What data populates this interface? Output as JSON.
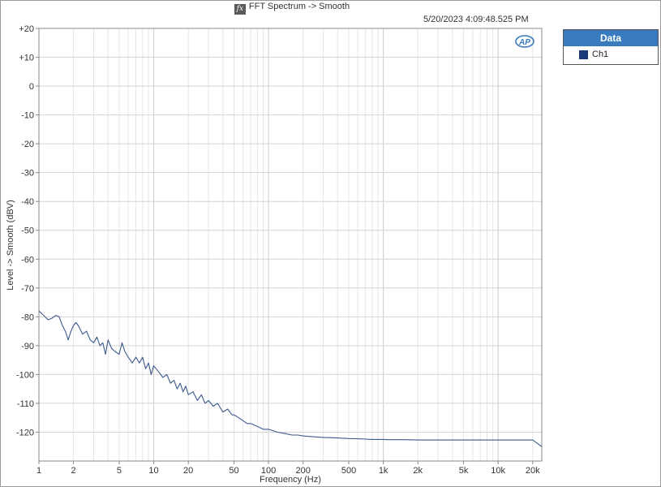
{
  "header": {
    "title": "FFT Spectrum -> Smooth",
    "timestamp": "5/20/2023 4:09:48.525 PM",
    "logo_text": "AP"
  },
  "legend": {
    "title": "Data",
    "items": [
      {
        "name": "Ch1",
        "color": "#1c3a7a"
      }
    ]
  },
  "chart_data": {
    "type": "line",
    "xlabel": "Frequency (Hz)",
    "ylabel": "Level -> Smooth (dBV)",
    "xscale": "log",
    "xlim": [
      1,
      24000
    ],
    "ylim": [
      -130,
      20
    ],
    "xticks": [
      {
        "value": 1,
        "label": "1"
      },
      {
        "value": 2,
        "label": "2"
      },
      {
        "value": 5,
        "label": "5"
      },
      {
        "value": 10,
        "label": "10"
      },
      {
        "value": 20,
        "label": "20"
      },
      {
        "value": 50,
        "label": "50"
      },
      {
        "value": 100,
        "label": "100"
      },
      {
        "value": 200,
        "label": "200"
      },
      {
        "value": 500,
        "label": "500"
      },
      {
        "value": 1000,
        "label": "1k"
      },
      {
        "value": 2000,
        "label": "2k"
      },
      {
        "value": 5000,
        "label": "5k"
      },
      {
        "value": 10000,
        "label": "10k"
      },
      {
        "value": 20000,
        "label": "20k"
      }
    ],
    "yticks": [
      {
        "value": 20,
        "label": "+20"
      },
      {
        "value": 10,
        "label": "+10"
      },
      {
        "value": 0,
        "label": "0"
      },
      {
        "value": -10,
        "label": "-10"
      },
      {
        "value": -20,
        "label": "-20"
      },
      {
        "value": -30,
        "label": "-30"
      },
      {
        "value": -40,
        "label": "-40"
      },
      {
        "value": -50,
        "label": "-50"
      },
      {
        "value": -60,
        "label": "-60"
      },
      {
        "value": -70,
        "label": "-70"
      },
      {
        "value": -80,
        "label": "-80"
      },
      {
        "value": -90,
        "label": "-90"
      },
      {
        "value": -100,
        "label": "-100"
      },
      {
        "value": -110,
        "label": "-110"
      },
      {
        "value": -120,
        "label": "-120"
      }
    ],
    "grid": true,
    "legend_position": "right",
    "series": [
      {
        "name": "Ch1",
        "color": "#3d5a8a",
        "x": [
          1,
          1.1,
          1.2,
          1.3,
          1.4,
          1.5,
          1.6,
          1.7,
          1.8,
          1.9,
          2.0,
          2.1,
          2.2,
          2.4,
          2.6,
          2.8,
          3.0,
          3.2,
          3.4,
          3.6,
          3.8,
          4.0,
          4.3,
          4.6,
          5.0,
          5.3,
          5.6,
          6.0,
          6.5,
          7.0,
          7.5,
          8.0,
          8.5,
          9.0,
          9.5,
          10,
          11,
          12,
          13,
          14,
          15,
          16,
          17,
          18,
          19,
          20,
          22,
          24,
          26,
          28,
          30,
          33,
          36,
          40,
          44,
          48,
          50,
          55,
          60,
          65,
          70,
          80,
          90,
          100,
          120,
          140,
          160,
          180,
          200,
          250,
          300,
          400,
          500,
          600,
          700,
          800,
          900,
          1000,
          1100,
          1200,
          1500,
          2000,
          3000,
          5000,
          7000,
          10000,
          15000,
          20000,
          24000
        ],
        "y": [
          -78,
          -79.5,
          -81,
          -80.5,
          -79.5,
          -80,
          -83,
          -85,
          -88,
          -85,
          -83,
          -82,
          -83,
          -86,
          -85,
          -88,
          -89,
          -87,
          -90,
          -89,
          -93,
          -88,
          -91,
          -92,
          -93,
          -89,
          -92,
          -94,
          -96,
          -94,
          -96,
          -94,
          -98,
          -96,
          -100,
          -97,
          -99,
          -101,
          -100,
          -103,
          -102,
          -105,
          -103,
          -106,
          -104,
          -107,
          -106,
          -109,
          -107,
          -110,
          -109,
          -111,
          -110,
          -113,
          -112,
          -114,
          -114,
          -115,
          -116,
          -117,
          -117,
          -118,
          -119,
          -119,
          -120,
          -120.5,
          -121,
          -121,
          -121.3,
          -121.6,
          -121.8,
          -122,
          -122.2,
          -122.3,
          -122.4,
          -122.5,
          -122.5,
          -122.5,
          -122.6,
          -122.6,
          -122.6,
          -122.7,
          -122.7,
          -122.7,
          -122.7,
          -122.7,
          -122.7,
          -122.7,
          -125
        ]
      }
    ]
  }
}
